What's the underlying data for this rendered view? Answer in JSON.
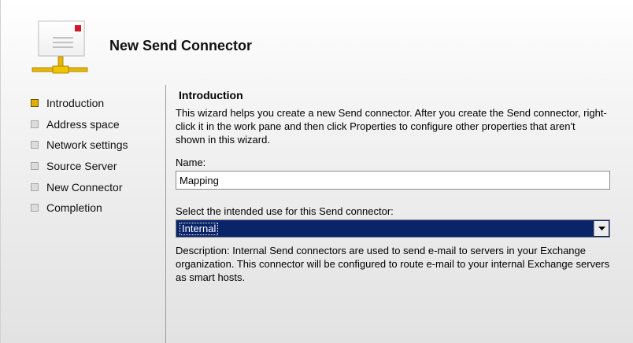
{
  "wizard": {
    "title": "New Send Connector",
    "icon": "send-connector-envelope-icon"
  },
  "steps": [
    {
      "label": "Introduction",
      "active": true
    },
    {
      "label": "Address space",
      "active": false
    },
    {
      "label": "Network settings",
      "active": false
    },
    {
      "label": "Source Server",
      "active": false
    },
    {
      "label": "New Connector",
      "active": false
    },
    {
      "label": "Completion",
      "active": false
    }
  ],
  "main": {
    "section_title": "Introduction",
    "intro": "This wizard helps you create a new Send connector. After you create the Send connector, right-click it in the work pane and then click Properties to configure other properties that aren't shown in this wizard.",
    "name_label": "Name:",
    "name_value": "Mapping",
    "use_label": "Select the intended use for this Send connector:",
    "use_value": "Internal",
    "description": "Description: Internal Send connectors are used to send e-mail to servers in your Exchange organization. This connector will be configured to route e-mail to your internal Exchange servers as smart hosts."
  },
  "colors": {
    "active_step": "#e0b000",
    "select_highlight": "#0a246a"
  }
}
